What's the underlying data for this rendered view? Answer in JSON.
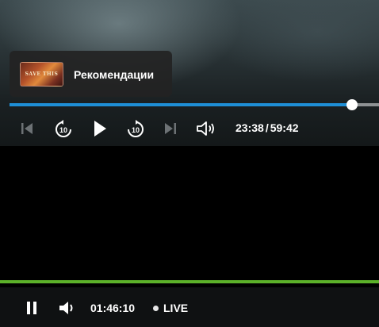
{
  "recommendations": {
    "label": "Рекомендации",
    "thumbnail_title": "SAVE THIS"
  },
  "player": {
    "progress_fraction": 0.927,
    "current_time": "23:38",
    "separator": "/",
    "duration": "59:42",
    "icons": {
      "previous": "skip-previous-icon",
      "rewind": "rewind-10-icon",
      "rewind_label": "10",
      "play": "play-icon",
      "forward": "forward-10-icon",
      "forward_label": "10",
      "next": "skip-next-icon",
      "volume": "volume-icon"
    },
    "colors": {
      "progress": "#1e8fd6",
      "track": "#8e9294"
    }
  },
  "live_bar": {
    "time": "01:46:10",
    "live_label": "LIVE",
    "icons": {
      "pause": "pause-icon",
      "volume": "volume-icon"
    },
    "colors": {
      "accent_line": "#5cb12a"
    }
  }
}
